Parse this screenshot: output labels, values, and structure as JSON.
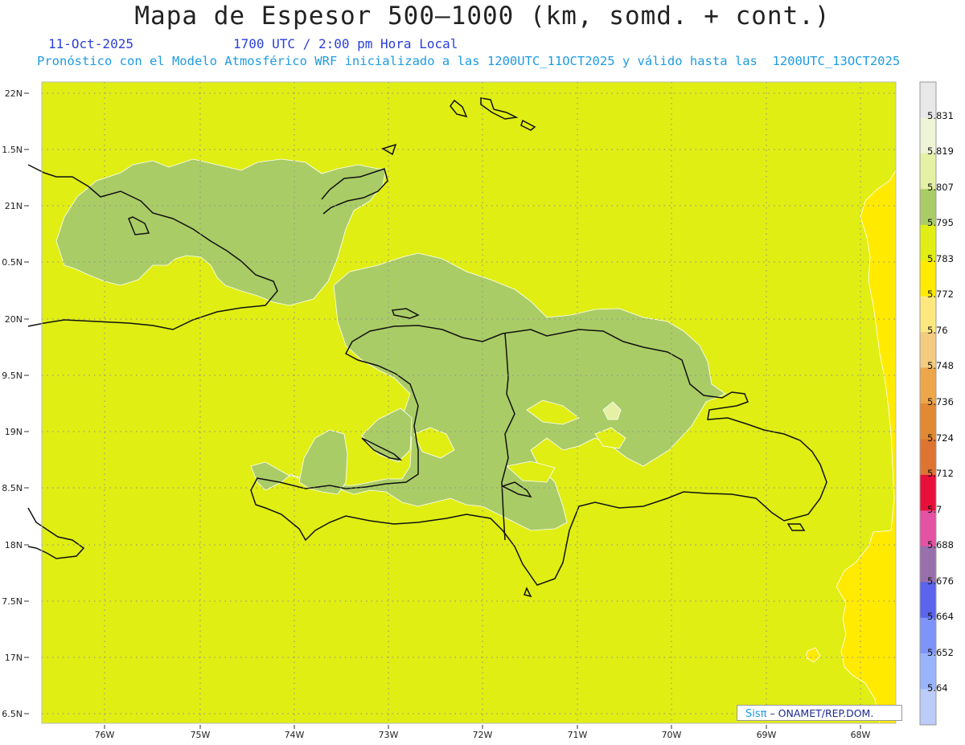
{
  "title": "Mapa de Espesor 500—1000 (km, somd. + cont.)",
  "header": {
    "date": "11-Oct-2025",
    "time": "1700 UTC / 2:00 pm Hora Local",
    "forecast": "Pronóstico con el Modelo Atmosférico WRF inicializado a las 1200UTC_11OCT2025 y válido hasta las  1200UTC_13OCT2025"
  },
  "axes": {
    "lat_labels": [
      "22N",
      "1.5N",
      "21N",
      "0.5N",
      "20N",
      "9.5N",
      "19N",
      "8.5N",
      "18N",
      "7.5N",
      "17N",
      "6.5N"
    ],
    "lon_labels": [
      "76W",
      "75W",
      "74W",
      "73W",
      "72W",
      "71W",
      "70W",
      "69W",
      "68W"
    ]
  },
  "colorbar": {
    "labels": [
      "5.831",
      "5.819",
      "5.807",
      "5.795",
      "5.783",
      "5.772",
      "5.76",
      "5.748",
      "5.736",
      "5.724",
      "5.712",
      "5.7",
      "5.688",
      "5.676",
      "5.664",
      "5.652",
      "5.64"
    ],
    "colors_top_to_bottom": [
      "#e8e8e8",
      "#eef4d6",
      "#e4f0a4",
      "#aacc66",
      "#e0ee14",
      "#ffea00",
      "#fde880",
      "#f3cc80",
      "#eda649",
      "#e28a33",
      "#de7432",
      "#e8103a",
      "#e452a4",
      "#9a70ac",
      "#5a64ec",
      "#7e94f8",
      "#9ab4fc",
      "#bcccf8"
    ]
  },
  "fill_colors": {
    "background": "#e0ee14",
    "thicker_zone": "#aacc66",
    "thinner_zone": "#ffea00",
    "highest_zone": "#e4f0a4"
  },
  "credit": {
    "logo": "Sisπ",
    "text": "– ONAMET/REP.DOM."
  }
}
